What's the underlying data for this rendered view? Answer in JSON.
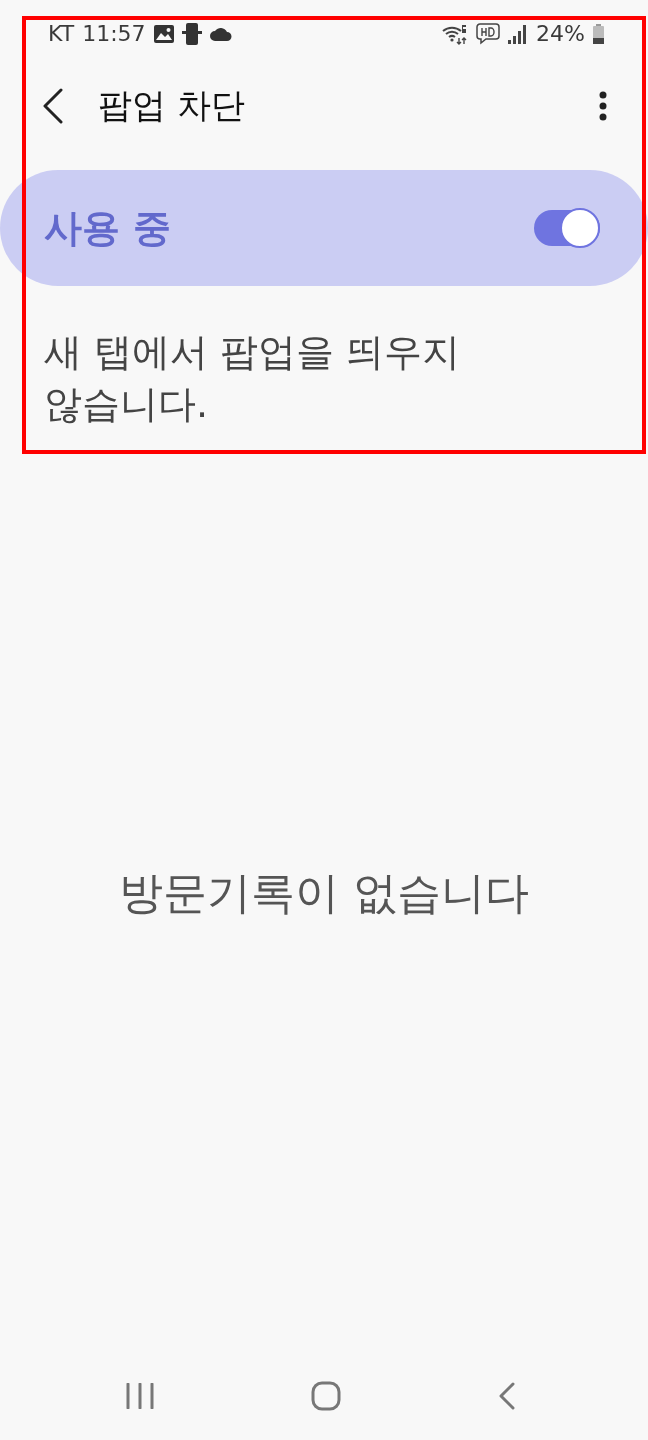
{
  "status_bar": {
    "carrier": "KT",
    "time": "11:57",
    "battery_percent": "24%"
  },
  "header": {
    "title": "팝업 차단"
  },
  "master_switch": {
    "label": "사용 중",
    "on": true
  },
  "description": "새 탭에서 팝업을 띄우지 않습니다.",
  "empty_state": {
    "message": "방문기록이 없습니다"
  }
}
